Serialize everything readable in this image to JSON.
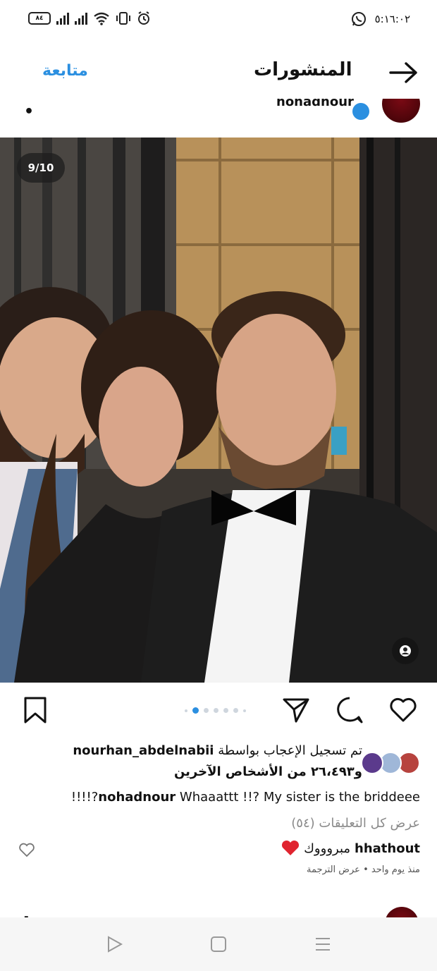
{
  "status_bar": {
    "battery": "٨٤",
    "time": "٥:١٦:٠٢",
    "icons": [
      "battery-icon",
      "signal-icon",
      "signal-icon",
      "wifi-icon",
      "vibrate-icon",
      "alarm-icon",
      "whatsapp-icon"
    ]
  },
  "header": {
    "follow_label": "متابعة",
    "title": "المنشورات",
    "back_icon": "arrow-right-icon"
  },
  "post": {
    "username": "nohadnour",
    "image_counter": "9/10",
    "carousel": {
      "total": 10,
      "current": 9
    },
    "likes_line1": "تم تسجيل الإعجاب بواسطة",
    "likes_user": "nourhan_abdelnabii",
    "likes_line2": "و٢٦،٤٩٣ من الأشخاص الآخرين",
    "caption_user": "nohadnour",
    "caption_text": "Whaaattt !!? My sister is the briddeee?!!!!",
    "view_comments": "عرض كل التعليقات (٥٤)",
    "comment_user": "hhathout",
    "comment_text": "مبروووك",
    "comment_time": "منذ يوم واحد",
    "comment_translate": "عرض الترجمة",
    "colors": {
      "accent": "#2b8fe0",
      "heart": "#e0242f"
    }
  }
}
